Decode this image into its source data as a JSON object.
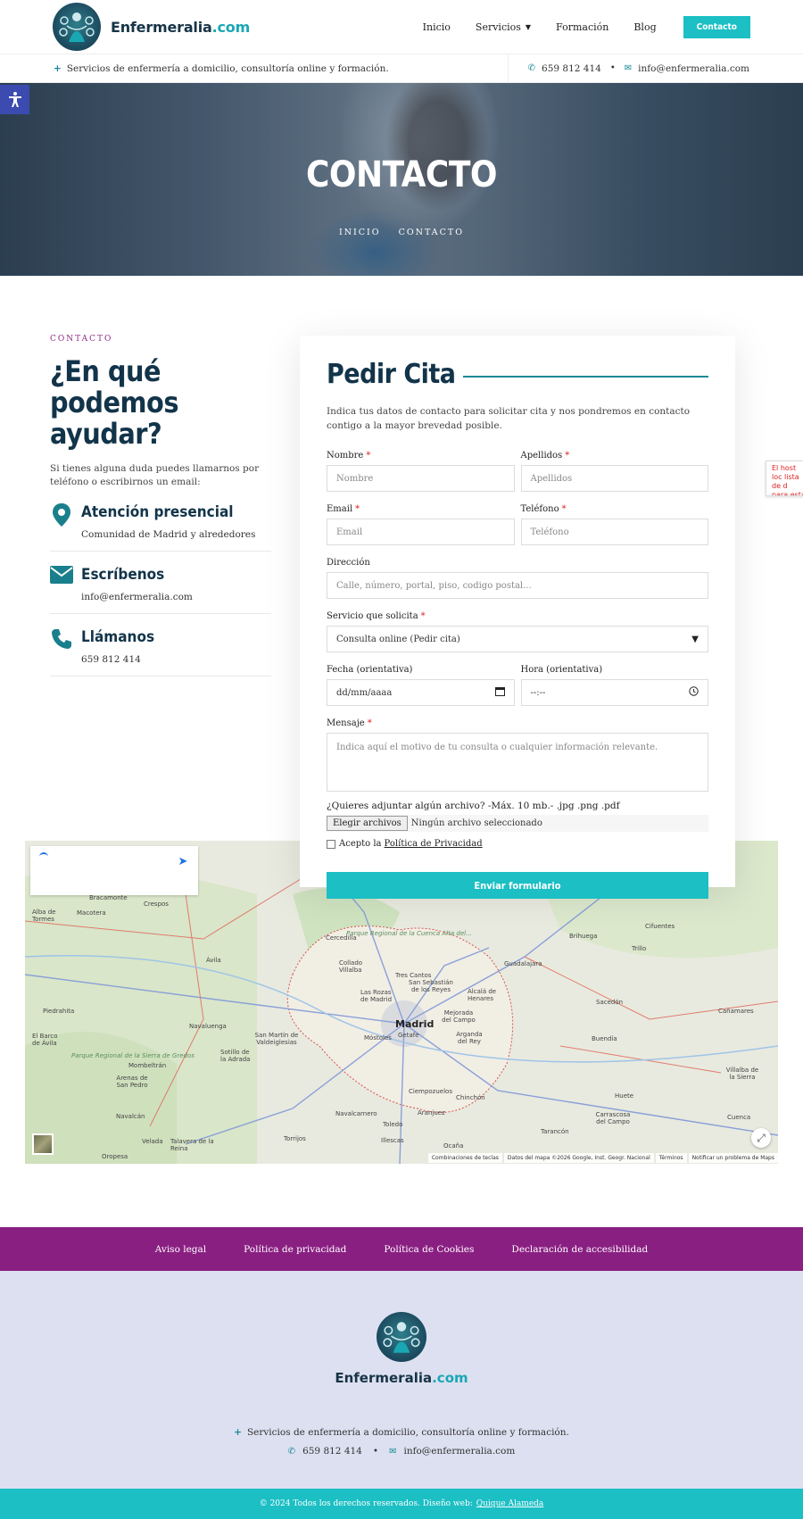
{
  "header": {
    "brand_main": "Enfermeralia",
    "brand_accent": ".com",
    "nav": [
      "Inicio",
      "Servicios",
      "Formación",
      "Blog"
    ],
    "cta": "Contacto"
  },
  "topbar": {
    "tagline": "Servicios de enfermería a domicilio, consultoría online y formación.",
    "phone": "659 812 414",
    "email": "info@enfermeralia.com"
  },
  "hero": {
    "title": "CONTACTO",
    "breadcrumb": [
      "INICIO",
      "CONTACTO"
    ]
  },
  "contact": {
    "eyebrow": "CONTACTO",
    "title": "¿En qué podemos ayudar?",
    "intro": "Si tienes alguna duda puedes llamarnos por teléfono o escribirnos un email:",
    "items": [
      {
        "title": "Atención presencial",
        "text": "Comunidad de Madrid y alrededores",
        "icon": "map-pin-icon"
      },
      {
        "title": "Escríbenos",
        "text": "info@enfermeralia.com",
        "icon": "envelope-icon"
      },
      {
        "title": "Llámanos",
        "text": "659 812 414",
        "icon": "phone-icon"
      }
    ]
  },
  "form": {
    "title": "Pedir Cita",
    "desc": "Indica tus datos de contacto para solicitar cita y nos pondremos en contacto contigo a la mayor brevedad posible.",
    "nombre_label": "Nombre",
    "nombre_ph": "Nombre",
    "apellidos_label": "Apellidos",
    "apellidos_ph": "Apellidos",
    "email_label": "Email",
    "email_ph": "Email",
    "telefono_label": "Teléfono",
    "telefono_ph": "Teléfono",
    "direccion_label": "Dirección",
    "direccion_ph": "Calle, número, portal, piso, codigo postal...",
    "servicio_label": "Servicio que solicita",
    "servicio_value": "Consulta online (Pedir cita)",
    "fecha_label": "Fecha (orientativa)",
    "fecha_value": "dd/mm/aaaa",
    "hora_label": "Hora (orientativa)",
    "hora_value": "--:--",
    "mensaje_label": "Mensaje",
    "mensaje_ph": "Indica aquí el motivo de tu consulta o cualquier información relevante.",
    "file_label": "¿Quieres adjuntar algún archivo? -Máx. 10 mb.- .jpg .png .pdf",
    "file_button": "Elegir archivos",
    "file_status": "Ningún archivo seleccionado",
    "privacy_prefix": "Acepto la",
    "privacy_link": "Política de Privacidad",
    "submit": "Enviar formulario"
  },
  "recaptcha_text": "El host loc lista de d para esta",
  "map": {
    "cities": [
      "Madrid",
      "Getafe",
      "Móstoles",
      "Las Rozas de Madrid",
      "Alcalá de Henares",
      "Guadalajara",
      "Ávila",
      "Toledo",
      "Aranjuez",
      "Navalcarnero",
      "Collado Villalba",
      "Tres Cantos",
      "San Sebastián de los Reyes",
      "Brihuega",
      "Sacedón",
      "Cañamares",
      "Buendía",
      "Huete",
      "Tarancón",
      "Ocaña",
      "Illescas",
      "Torrijos",
      "Talavera de la Reina",
      "Velada",
      "Oropesa",
      "Navaluenga",
      "Piedrahita",
      "Bracamonte",
      "Crespos",
      "Alba de Tormes",
      "Macotera",
      "Cercedilla",
      "Trillo",
      "Cifuentes",
      "Chinchón",
      "Cuenca",
      "Arganda del Rey",
      "Mejorada del Campo",
      "Carrascosa del Campo",
      "Sotillo de la Adrada",
      "San Martín de Valdeiglesias",
      "Arenas de San Pedro",
      "Mombeltrán",
      "Navalcán",
      "El Barco de Ávila",
      "Ciempozuelos",
      "Villalba de la Sierra"
    ],
    "parks": [
      "Parque Regional de la Cuenca Alta del...",
      "Parque Regional de la Sierra de Gredos"
    ],
    "footer": [
      "Combinaciones de teclas",
      "Datos del mapa ©2026 Google, Inst. Geogr. Nacional",
      "Términos",
      "Notificar un problema de Maps"
    ]
  },
  "legal_links": [
    "Aviso legal",
    "Política de privacidad",
    "Política de Cookies",
    "Declaración de accesibilidad"
  ],
  "footer": {
    "brand_main": "Enfermeralia",
    "brand_accent": ".com",
    "tagline": "Servicios de enfermería a domicilio, consultoría online y formación.",
    "phone": "659 812 414",
    "email": "info@enfermeralia.com"
  },
  "copyright": {
    "text": "© 2024 Todos los derechos reservados. Diseño web:",
    "link": "Quique Alameda"
  },
  "colors": {
    "teal": "#1bbfc4",
    "purple": "#8a1f82",
    "navy": "#12344a",
    "footer_bg": "#dde0f0"
  }
}
